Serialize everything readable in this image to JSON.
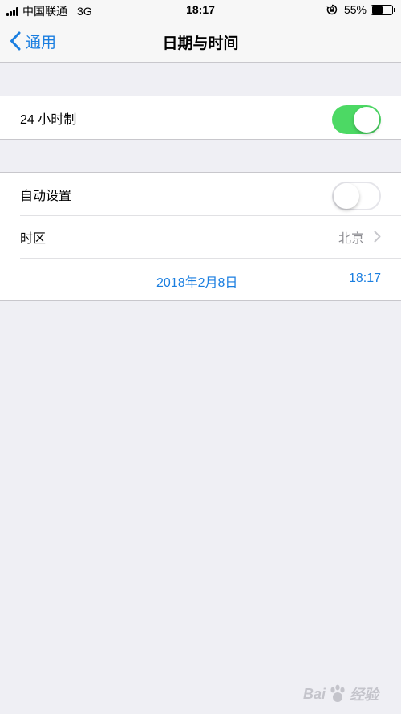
{
  "status_bar": {
    "carrier": "中国联通",
    "network": "3G",
    "time": "18:17",
    "battery_percent": "55%",
    "battery_level": 0.55
  },
  "nav": {
    "back_label": "通用",
    "title": "日期与时间"
  },
  "settings": {
    "hour24": {
      "label": "24 小时制",
      "enabled": true
    },
    "auto_set": {
      "label": "自动设置",
      "enabled": false
    },
    "timezone": {
      "label": "时区",
      "value": "北京"
    },
    "date": "2018年2月8日",
    "time": "18:17"
  },
  "watermark": {
    "text_left": "Bai",
    "text_right": "经验"
  },
  "colors": {
    "accent": "#1a7ee0",
    "toggle_on": "#4cd964",
    "background": "#efeff4"
  }
}
